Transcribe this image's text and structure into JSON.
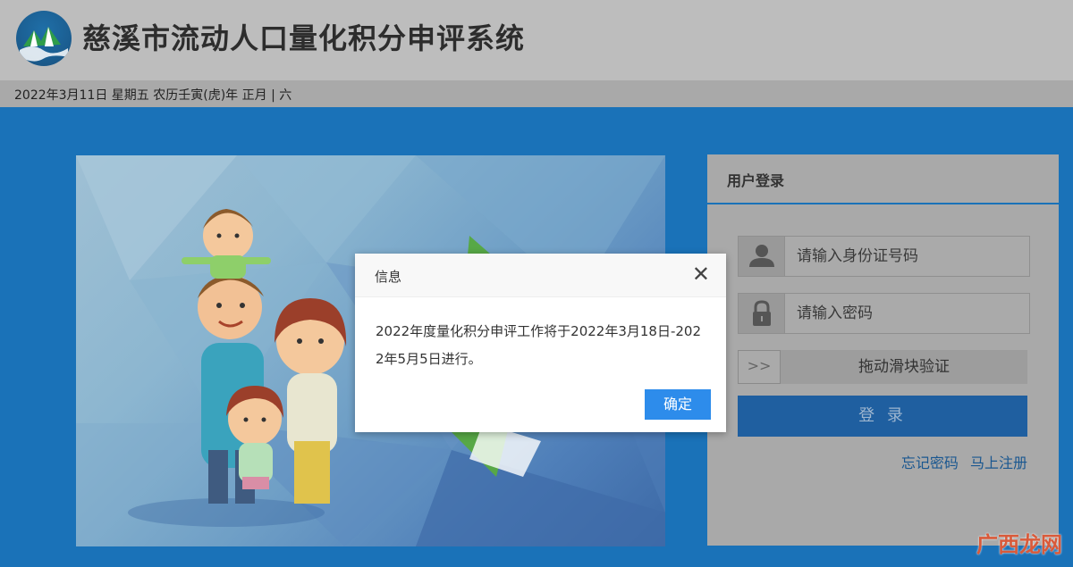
{
  "header": {
    "site_title": "慈溪市流动人口量化积分申评系统",
    "date_line": "2022年3月11日 星期五 农历壬寅(虎)年 正月 | 六"
  },
  "login": {
    "title": "用户登录",
    "id_placeholder": "请输入身份证号码",
    "password_placeholder": "请输入密码",
    "slider_handle": ">>",
    "slider_text": "拖动滑块验证",
    "login_button": "登 录",
    "forgot_password": "忘记密码",
    "register": "马上注册"
  },
  "dialog": {
    "title": "信息",
    "close_glyph": "✕",
    "message": "2022年度量化积分申评工作将于2022年3月18日-2022年5月5日进行。",
    "ok_button": "确定"
  },
  "watermark": "广西龙网",
  "colors": {
    "page_bg": "#1a72b8",
    "header_bg": "#bdbdbd",
    "login_button": "#1f5fa0",
    "dialog_ok": "#2d8ceb"
  },
  "icons": [
    "logo-icon",
    "user-icon",
    "lock-icon",
    "close-icon"
  ]
}
